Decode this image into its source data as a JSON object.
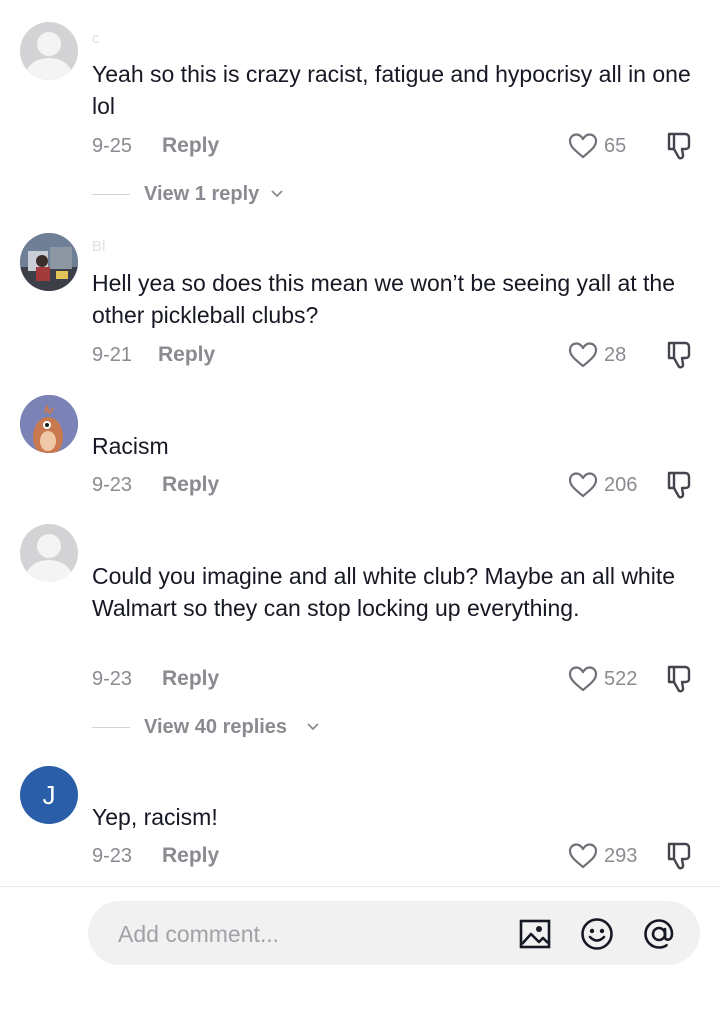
{
  "comments": [
    {
      "username": "c",
      "text": "Yeah so this is crazy racist, fatigue and hypocrisy all in one lol",
      "date": "9-25",
      "reply_label": "Reply",
      "likes": "65",
      "view_replies": "View 1 reply",
      "avatar_icon": "default-user-icon"
    },
    {
      "username": "Bl",
      "text": "Hell yea so does this mean we won’t be seeing yall at the other pickleball clubs?",
      "date": "9-21",
      "reply_label": "Reply",
      "likes": "28",
      "avatar_icon": "photo-avatar"
    },
    {
      "username": "",
      "text": "Racism",
      "date": "9-23",
      "reply_label": "Reply",
      "likes": "206",
      "avatar_icon": "bird-avatar"
    },
    {
      "username": "",
      "text": "Could you imagine and all white club? Maybe an all white Walmart so they can stop locking up everything.",
      "date": "9-23",
      "reply_label": "Reply",
      "likes": "522",
      "view_replies": "View 40 replies",
      "avatar_icon": "default-user-icon"
    },
    {
      "username": "",
      "text": "Yep, racism!",
      "date": "9-23",
      "reply_label": "Reply",
      "likes": "293",
      "avatar_letter": "J",
      "avatar_color": "#2a5ea8"
    }
  ],
  "composer": {
    "placeholder": "Add comment...",
    "icons": [
      "image-icon",
      "emoji-icon",
      "mention-icon"
    ]
  },
  "colors": {
    "text_primary": "#161823",
    "text_secondary": "#8a8b91",
    "input_background": "#f1f1f2"
  }
}
